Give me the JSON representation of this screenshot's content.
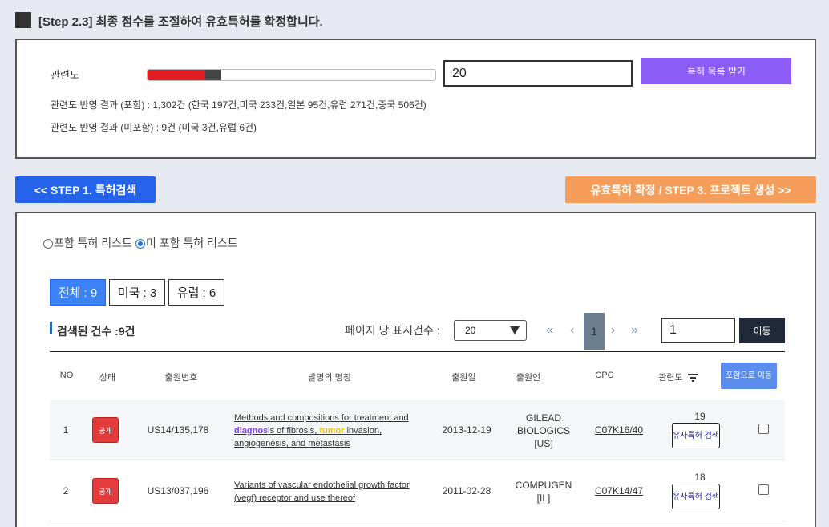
{
  "header": {
    "title": "[Step 2.3] 최종 점수를 조절하여 유효특허를 확정합니다."
  },
  "relevance": {
    "label": "관련도",
    "slider_fraction": 0.2,
    "input_value": "20",
    "get_list_button": "특허 목록 받기",
    "result_included": "관련도 반영 결과 (포함) : 1,302건 (한국 197건,미국 233건,일본 95건,유럽 271건,중국 506건)",
    "result_excluded": "관련도 반영 결과 (미포함) : 9건 (미국 3건,유럽 6건)"
  },
  "nav": {
    "step1_button": "<< STEP 1. 특허검색",
    "step3_button": "유효특허 확정 / STEP 3. 프로젝트 생성 >>"
  },
  "list_radio": {
    "included_label": "포함 특허 리스트",
    "excluded_label": "미 포함 특허 리스트",
    "selected": "excluded"
  },
  "chips": [
    {
      "label": "전체 : 9",
      "active": true
    },
    {
      "label": "미국 : 3",
      "active": false
    },
    {
      "label": "유럽 : 6",
      "active": false
    }
  ],
  "toolbar": {
    "count_label": "검색된 건수 :9건",
    "per_page_label": "페이지 당 표시건수 :",
    "per_page_value": "20",
    "pagination": {
      "first": "«",
      "prev": "‹",
      "current": "1",
      "next": "›",
      "last": "»"
    },
    "page_input_value": "1",
    "go_button": "이동"
  },
  "table": {
    "headers": {
      "no": "NO",
      "status": "상태",
      "app_no": "출원번호",
      "title": "발명의 명칭",
      "app_date": "출원일",
      "applicant": "출원인",
      "cpc": "CPC",
      "relevance": "관련도",
      "include_button": "포함으로 이동"
    },
    "rows": [
      {
        "no": "1",
        "status": "공개",
        "app_no": "US14/135,178",
        "title_before": "Methods and compositions for treatment and ",
        "title_hl1": "diagnos",
        "title_mid": "is of fibrosis, ",
        "title_hl2": "tumor",
        "title_after": " invasion, angiogenesis, and metastasis",
        "app_date": "2013-12-19",
        "applicant_line1": "GILEAD",
        "applicant_line2": "BIOLOGICS",
        "applicant_line3": "[US]",
        "cpc": "C07K16/40",
        "relevance": "19",
        "similar_button": "유사특허 검색"
      },
      {
        "no": "2",
        "status": "공개",
        "app_no": "US13/037,196",
        "title_full": "Variants of vascular endothelial growth factor (vegf) receptor and use thereof",
        "app_date": "2011-02-28",
        "applicant_line1": "COMPUGEN",
        "applicant_line2": "[IL]",
        "cpc": "C07K14/47",
        "relevance": "18",
        "similar_button": "유사특허 검색"
      }
    ]
  }
}
